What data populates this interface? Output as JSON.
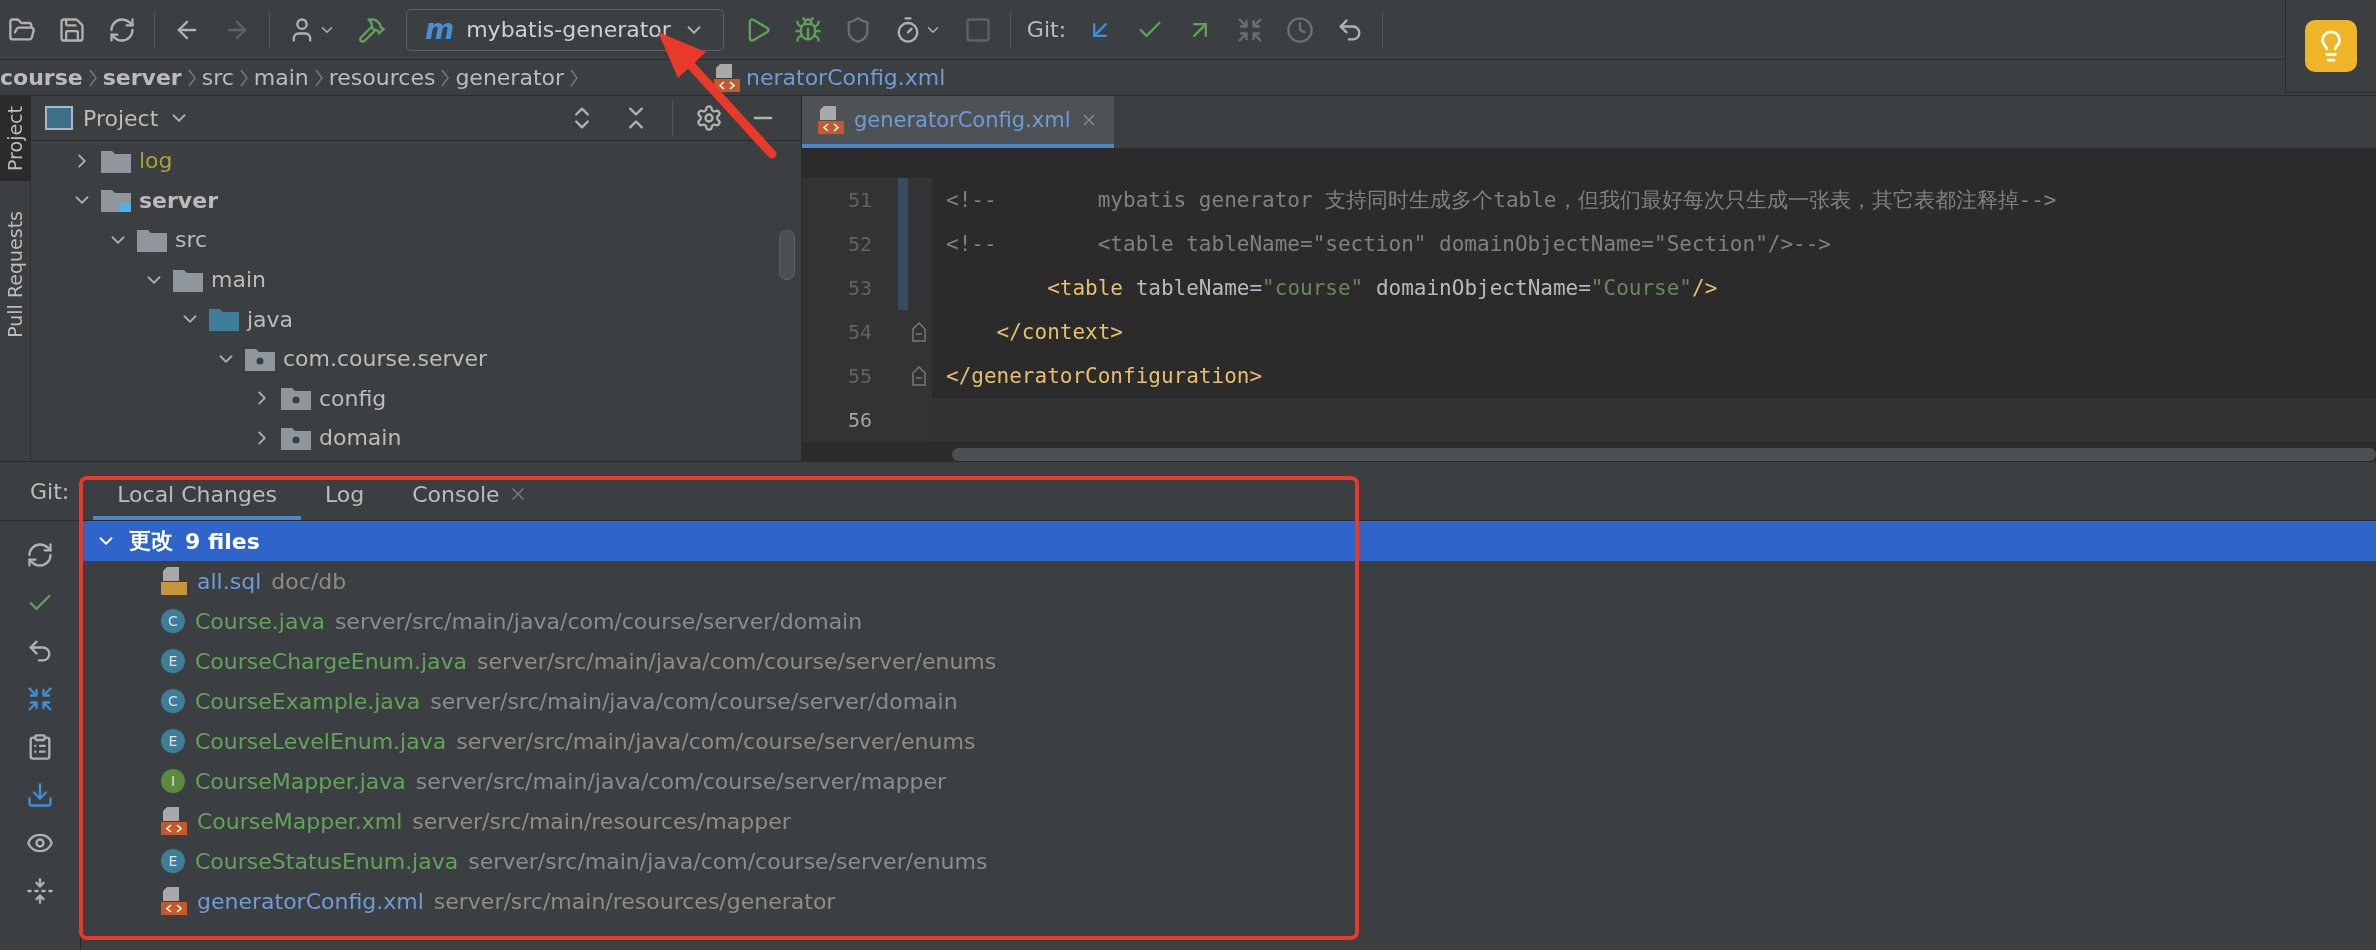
{
  "toolbar": {
    "run_config": {
      "badge": "m",
      "label": "mybatis-generator"
    },
    "git_label": "Git:"
  },
  "breadcrumb": [
    {
      "label": "course",
      "kind": "module"
    },
    {
      "label": "server",
      "kind": "module"
    },
    {
      "label": "src",
      "kind": "dir"
    },
    {
      "label": "main",
      "kind": "dir"
    },
    {
      "label": "resources",
      "kind": "dir"
    },
    {
      "label": "generator",
      "kind": "dir"
    },
    {
      "label": "neratorConfig.xml",
      "kind": "file"
    }
  ],
  "side_tabs": [
    {
      "label": "Project",
      "selected": true
    },
    {
      "label": "Pull Requests",
      "selected": false
    }
  ],
  "project_panel": {
    "title": "Project",
    "tree": [
      {
        "label": "log",
        "kind": "folder",
        "expanded": false,
        "ignored": true
      },
      {
        "label": "server",
        "kind": "module",
        "expanded": true,
        "ignored": false,
        "children": [
          {
            "label": "src",
            "kind": "folder",
            "expanded": true,
            "ignored": false,
            "children": [
              {
                "label": "main",
                "kind": "folder",
                "expanded": true,
                "ignored": false,
                "children": [
                  {
                    "label": "java",
                    "kind": "source",
                    "expanded": true,
                    "ignored": false,
                    "children": [
                      {
                        "label": "com.course.server",
                        "kind": "package",
                        "expanded": true,
                        "ignored": false,
                        "children": [
                          {
                            "label": "config",
                            "kind": "package",
                            "expanded": false,
                            "ignored": false
                          },
                          {
                            "label": "domain",
                            "kind": "package",
                            "expanded": false,
                            "ignored": false
                          }
                        ]
                      }
                    ]
                  }
                ]
              }
            ]
          }
        ]
      }
    ]
  },
  "editor": {
    "tabs": [
      {
        "label": "generatorConfig.xml",
        "selected": true
      }
    ],
    "lines": [
      {
        "number": "51",
        "current": false,
        "changed": true,
        "fold": false,
        "segments": [
          {
            "kind": "comment",
            "text": "<!--        mybatis generator 支持同时生成多个table，但我们最好每次只生成一张表，其它表都注释掉-->"
          }
        ]
      },
      {
        "number": "52",
        "current": false,
        "changed": true,
        "fold": false,
        "segments": [
          {
            "kind": "comment",
            "text": "<!--        <table tableName=\"section\" domainObjectName=\"Section\"/>-->"
          }
        ]
      },
      {
        "number": "53",
        "current": false,
        "changed": true,
        "fold": false,
        "segments": [
          {
            "kind": "tag",
            "text": "        <table"
          },
          {
            "kind": "attr",
            "text": " tableName"
          },
          {
            "kind": "plain",
            "text": "="
          },
          {
            "kind": "value",
            "text": "\"course\""
          },
          {
            "kind": "attr",
            "text": " domainObjectName"
          },
          {
            "kind": "plain",
            "text": "="
          },
          {
            "kind": "value",
            "text": "\"Course\""
          },
          {
            "kind": "tag",
            "text": "/>"
          }
        ]
      },
      {
        "number": "54",
        "current": false,
        "changed": false,
        "fold": true,
        "segments": [
          {
            "kind": "tag",
            "text": "    </context>"
          }
        ]
      },
      {
        "number": "55",
        "current": false,
        "changed": false,
        "fold": true,
        "segments": [
          {
            "kind": "tag",
            "text": "</generatorConfiguration>"
          }
        ]
      },
      {
        "number": "56",
        "current": true,
        "changed": false,
        "fold": false
      }
    ]
  },
  "vcs_panel": {
    "label": "Git:",
    "tabs": [
      {
        "label": "Local Changes",
        "selected": true,
        "closable": false
      },
      {
        "label": "Log",
        "selected": false,
        "closable": false
      },
      {
        "label": "Console",
        "selected": false,
        "closable": true
      }
    ],
    "changelist": {
      "name": "更改",
      "count": "9 files",
      "expanded": true,
      "selected": true,
      "files": [
        {
          "name": "all.sql",
          "path": "doc/db",
          "kind": "sql",
          "color": "#6d9cd6"
        },
        {
          "name": "Course.java",
          "path": "server/src/main/java/com/course/server/domain",
          "kind": "class",
          "badge": "C",
          "color": "#62a35c"
        },
        {
          "name": "CourseChargeEnum.java",
          "path": "server/src/main/java/com/course/server/enums",
          "kind": "class",
          "badge": "E",
          "color": "#62a35c"
        },
        {
          "name": "CourseExample.java",
          "path": "server/src/main/java/com/course/server/domain",
          "kind": "class",
          "badge": "C",
          "color": "#62a35c"
        },
        {
          "name": "CourseLevelEnum.java",
          "path": "server/src/main/java/com/course/server/enums",
          "kind": "class",
          "badge": "E",
          "color": "#62a35c"
        },
        {
          "name": "CourseMapper.java",
          "path": "server/src/main/java/com/course/server/mapper",
          "kind": "interface",
          "badge": "I",
          "color": "#62a35c"
        },
        {
          "name": "CourseMapper.xml",
          "path": "server/src/main/resources/mapper",
          "kind": "xml",
          "color": "#62a35c"
        },
        {
          "name": "CourseStatusEnum.java",
          "path": "server/src/main/java/com/course/server/enums",
          "kind": "class",
          "badge": "E",
          "color": "#62a35c"
        },
        {
          "name": "generatorConfig.xml",
          "path": "server/src/main/resources/generator",
          "kind": "xml",
          "color": "#6d9cd6"
        }
      ]
    }
  }
}
